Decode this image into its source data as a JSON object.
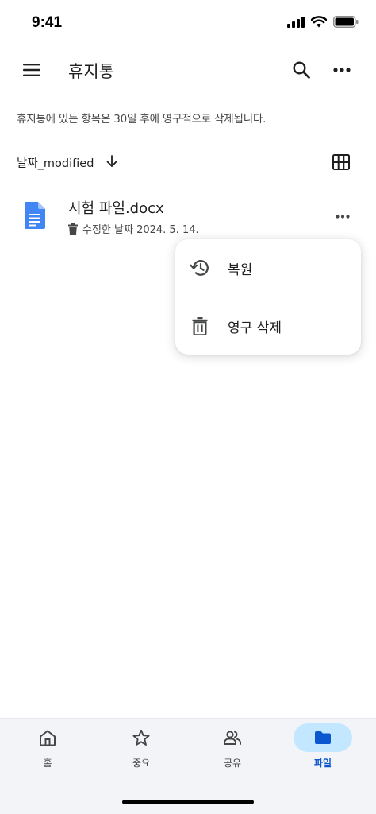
{
  "status_bar": {
    "time": "9:41"
  },
  "app_bar": {
    "title": "휴지통",
    "menu_icon": "hamburger-menu-icon",
    "search_icon": "search-icon",
    "more_icon": "more-horizontal-icon"
  },
  "notice": "휴지통에 있는 항목은 30일 후에 영구적으로 삭제됩니다.",
  "sort": {
    "label": "날짜_modified",
    "direction_icon": "arrow-down-icon",
    "view_icon": "grid-view-icon"
  },
  "files": [
    {
      "name": "시험 파일.docx",
      "meta": "수정한 날짜 2024. 5. 14.",
      "type_icon": "google-docs-icon",
      "meta_icon": "trash-icon"
    }
  ],
  "context_menu": {
    "items": [
      {
        "label": "복원",
        "icon": "restore-history-icon"
      },
      {
        "label": "영구 삭제",
        "icon": "trash-icon"
      }
    ]
  },
  "bottom_nav": {
    "items": [
      {
        "label": "홈",
        "icon": "home-icon",
        "active": false
      },
      {
        "label": "중요",
        "icon": "star-icon",
        "active": false
      },
      {
        "label": "공유",
        "icon": "people-icon",
        "active": false
      },
      {
        "label": "파일",
        "icon": "folder-icon",
        "active": true
      }
    ]
  },
  "colors": {
    "accent": "#0b57d0",
    "active_pill": "#c2e7ff",
    "doc_blue": "#4285f4",
    "nav_bg": "#f2f4f8"
  }
}
